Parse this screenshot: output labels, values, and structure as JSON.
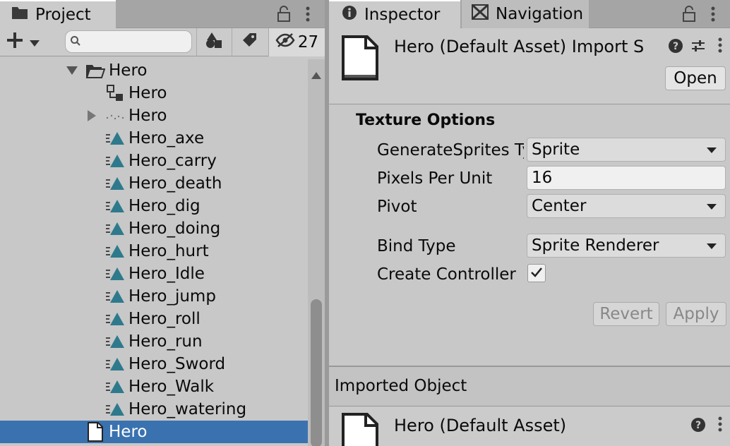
{
  "project": {
    "tab_label": "Project",
    "hidden_count": "27",
    "search": {
      "value": "",
      "placeholder": ""
    },
    "tree": [
      {
        "label": "Hero",
        "indent": 1,
        "icon": "folder-open-icon",
        "arrow": "expanded"
      },
      {
        "label": "Hero",
        "indent": 2,
        "icon": "prefab-variant-icon",
        "arrow": "none"
      },
      {
        "label": "Hero",
        "indent": 2,
        "icon": "animated-sprite-icon",
        "arrow": "collapsed"
      },
      {
        "label": "Hero_axe",
        "indent": 2,
        "icon": "animation-clip-icon",
        "arrow": "none"
      },
      {
        "label": "Hero_carry",
        "indent": 2,
        "icon": "animation-clip-icon",
        "arrow": "none"
      },
      {
        "label": "Hero_death",
        "indent": 2,
        "icon": "animation-clip-icon",
        "arrow": "none"
      },
      {
        "label": "Hero_dig",
        "indent": 2,
        "icon": "animation-clip-icon",
        "arrow": "none"
      },
      {
        "label": "Hero_doing",
        "indent": 2,
        "icon": "animation-clip-icon",
        "arrow": "none"
      },
      {
        "label": "Hero_hurt",
        "indent": 2,
        "icon": "animation-clip-icon",
        "arrow": "none"
      },
      {
        "label": "Hero_Idle",
        "indent": 2,
        "icon": "animation-clip-icon",
        "arrow": "none"
      },
      {
        "label": "Hero_jump",
        "indent": 2,
        "icon": "animation-clip-icon",
        "arrow": "none"
      },
      {
        "label": "Hero_roll",
        "indent": 2,
        "icon": "animation-clip-icon",
        "arrow": "none"
      },
      {
        "label": "Hero_run",
        "indent": 2,
        "icon": "animation-clip-icon",
        "arrow": "none"
      },
      {
        "label": "Hero_Sword",
        "indent": 2,
        "icon": "animation-clip-icon",
        "arrow": "none"
      },
      {
        "label": "Hero_Walk",
        "indent": 2,
        "icon": "animation-clip-icon",
        "arrow": "none"
      },
      {
        "label": "Hero_watering",
        "indent": 2,
        "icon": "animation-clip-icon",
        "arrow": "none"
      },
      {
        "label": "Hero",
        "indent": 1,
        "icon": "default-asset-icon",
        "arrow": "none",
        "selected": true
      }
    ]
  },
  "inspector": {
    "tab_label": "Inspector",
    "nav_tab_label": "Navigation",
    "header_title": "Hero (Default Asset) Import S",
    "open_label": "Open",
    "section_title": "Texture Options",
    "fields": {
      "generate_sprites_label": "GenerateSprites Ty",
      "generate_sprites_value": "Sprite",
      "pixels_per_unit_label": "Pixels Per Unit",
      "pixels_per_unit_value": "16",
      "pivot_label": "Pivot",
      "pivot_value": "Center",
      "bind_type_label": "Bind Type",
      "bind_type_value": "Sprite Renderer",
      "create_controller_label": "Create Controller",
      "create_controller_checked": true
    },
    "revert_label": "Revert",
    "apply_label": "Apply",
    "imported_object_label": "Imported Object",
    "imported_asset_title": "Hero (Default Asset)"
  },
  "colors": {
    "selection": "#3a72b0",
    "animation_icon": "#2e7a8c",
    "panel_bg": "#c8c8c8"
  }
}
